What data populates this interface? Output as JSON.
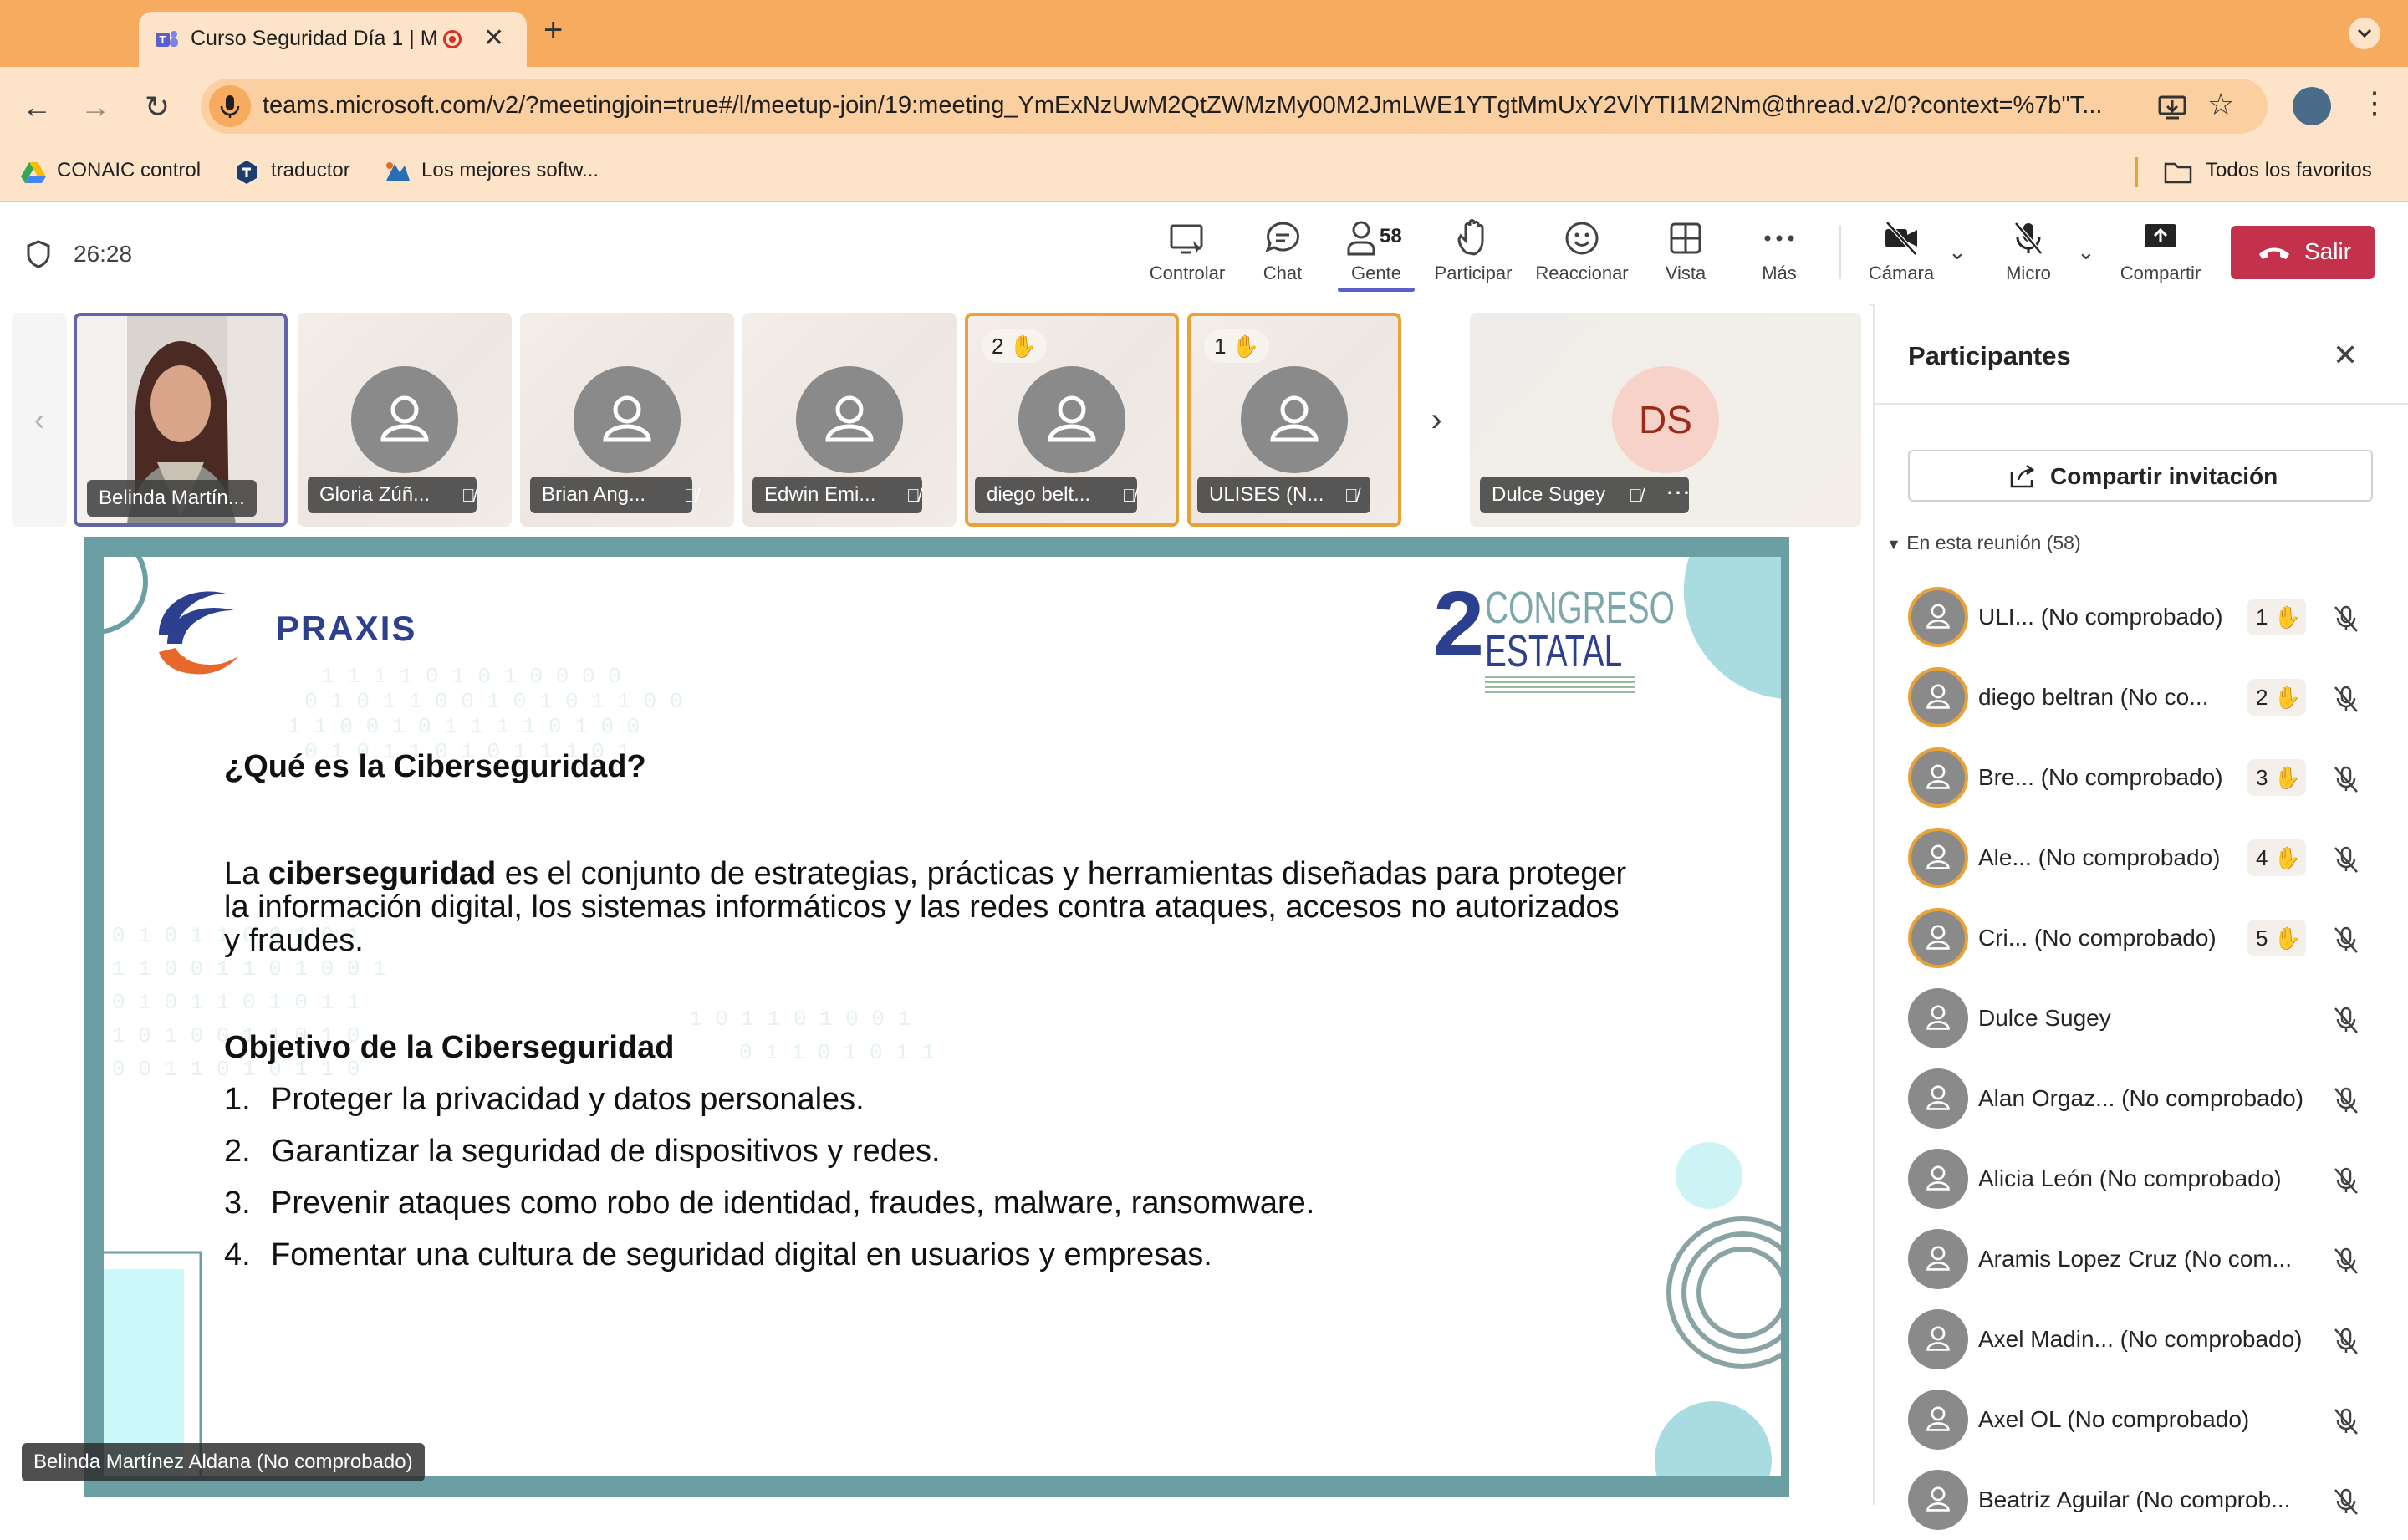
{
  "browser": {
    "tab_title": "Curso Seguridad Día 1 | M",
    "new_tab": "+",
    "url": "teams.microsoft.com/v2/?meetingjoin=true#/l/meetup-join/19:meeting_YmExNzUwM2QtZWMzMy00M2JmLWE1YTgtMmUxY2VlYTI1M2Nm@thread.v2/0?context=%7b\"T...",
    "bookmarks": [
      "CONAIC control",
      "traductor",
      "Los mejores softw..."
    ],
    "all_bookmarks": "Todos los favoritos"
  },
  "meeting": {
    "timer": "26:28",
    "toolbar": {
      "control": "Controlar",
      "chat": "Chat",
      "people": "Gente",
      "people_count": "58",
      "participate": "Participar",
      "react": "Reaccionar",
      "view": "Vista",
      "more": "Más",
      "camera": "Cámara",
      "mic": "Micro",
      "share": "Compartir",
      "leave": "Salir"
    },
    "thumbnails": [
      {
        "name": "Belinda Martín..."
      },
      {
        "name": "Gloria Zúñ..."
      },
      {
        "name": "Brian Ang..."
      },
      {
        "name": "Edwin Emi..."
      },
      {
        "name": "diego belt...",
        "hand": "2"
      },
      {
        "name": "ULISES (N...",
        "hand": "1"
      },
      {
        "name": "Dulce Sugey",
        "initials": "DS"
      }
    ],
    "presenter_label": "Belinda Martínez Aldana (No comprobado)"
  },
  "slide": {
    "logo_text": "PRAXIS",
    "congress_number": "2",
    "congress_line1": "CONGRESO",
    "congress_line2": "ESTATAL",
    "heading1": "¿Qué es la Ciberseguridad?",
    "para_prefix": "La ",
    "para_bold": "ciberseguridad",
    "para_line1_rest": " es el conjunto de estrategias, prácticas y herramientas diseñadas para proteger",
    "para_line2": "la información digital, los sistemas informáticos y las redes contra ataques, accesos no autorizados",
    "para_line3": "y fraudes.",
    "heading2": "Objetivo de la Ciberseguridad",
    "objectives": [
      {
        "num": "1.",
        "text": "Proteger la privacidad y datos personales."
      },
      {
        "num": "2.",
        "text": "Garantizar la seguridad de dispositivos y redes."
      },
      {
        "num": "3.",
        "text": "Prevenir ataques como robo de identidad, fraudes, malware, ransomware."
      },
      {
        "num": "4.",
        "text": "Fomentar una cultura de seguridad digital en usuarios y empresas."
      }
    ]
  },
  "participants": {
    "title": "Participantes",
    "invite": "Compartir invitación",
    "section": "En esta reunión (58)",
    "list": [
      {
        "name": "ULI... (No comprobado)",
        "hand": "1"
      },
      {
        "name": "diego beltran (No co...",
        "hand": "2"
      },
      {
        "name": "Bre... (No comprobado)",
        "hand": "3"
      },
      {
        "name": "Ale... (No comprobado)",
        "hand": "4"
      },
      {
        "name": "Cri... (No comprobado)",
        "hand": "5"
      },
      {
        "name": "Dulce Sugey"
      },
      {
        "name": "Alan Orgaz... (No comprobado)"
      },
      {
        "name": "Alicia León (No comprobado)"
      },
      {
        "name": "Aramis Lopez Cruz (No com..."
      },
      {
        "name": "Axel Madin... (No comprobado)"
      },
      {
        "name": "Axel OL (No comprobado)"
      },
      {
        "name": "Beatriz Aguilar (No comprob..."
      }
    ]
  },
  "colors": {
    "chrome_tab_strip": "#f6ab5e",
    "chrome_toolbar": "#fde3c8",
    "leave_red": "#c4314b",
    "raised_hand_border": "#e8a23a",
    "slide_frame": "#6c9fa3",
    "praxis_blue": "#2d3f8f",
    "praxis_orange": "#e8672a"
  }
}
